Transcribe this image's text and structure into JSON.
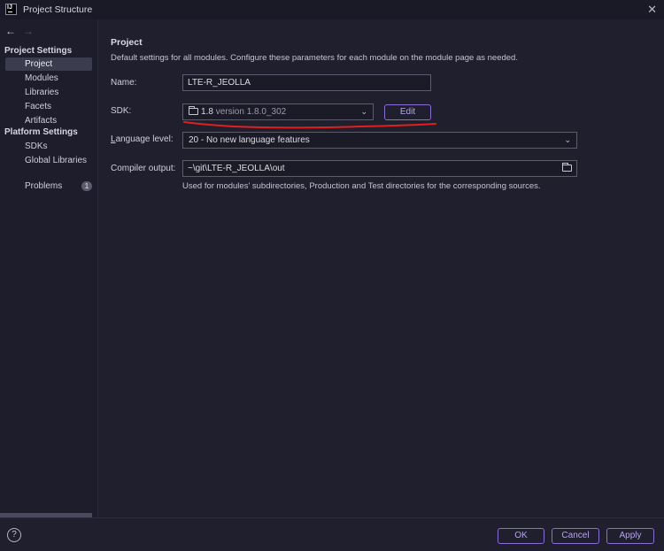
{
  "window": {
    "title": "Project Structure",
    "app_icon_text": "IJ",
    "close_glyph": "✕"
  },
  "sidebar": {
    "back_glyph": "←",
    "forward_glyph": "→",
    "project_settings_header": "Project Settings",
    "project_settings_items": [
      {
        "label": "Project",
        "selected": true
      },
      {
        "label": "Modules"
      },
      {
        "label": "Libraries"
      },
      {
        "label": "Facets"
      },
      {
        "label": "Artifacts"
      }
    ],
    "platform_settings_header": "Platform Settings",
    "platform_settings_items": [
      {
        "label": "SDKs"
      },
      {
        "label": "Global Libraries"
      }
    ],
    "problems": {
      "label": "Problems",
      "count": "1"
    }
  },
  "main": {
    "title": "Project",
    "description": "Default settings for all modules. Configure these parameters for each module on the module page as needed.",
    "name": {
      "label": "Name:",
      "value": "LTE-R_JEOLLA"
    },
    "sdk": {
      "label": "SDK:",
      "value_name": "1.8",
      "value_version": "version 1.8.0_302",
      "edit_label": "Edit",
      "annotation_color": "#e0201c"
    },
    "language_level": {
      "label_first": "L",
      "label_rest": "anguage level:",
      "value": "20 - No new language features"
    },
    "compiler_output": {
      "label": "Compiler output:",
      "value": "~\\git\\LTE-R_JEOLLA\\out",
      "help": "Used for modules' subdirectories, Production and Test directories for the corresponding sources."
    }
  },
  "footer": {
    "help_glyph": "?",
    "ok_label": "OK",
    "cancel_label": "Cancel",
    "apply_label": "Apply"
  },
  "colors": {
    "background": "#1f1f2e",
    "accent": "#8b6cd8",
    "selection": "#3b3c4e"
  }
}
